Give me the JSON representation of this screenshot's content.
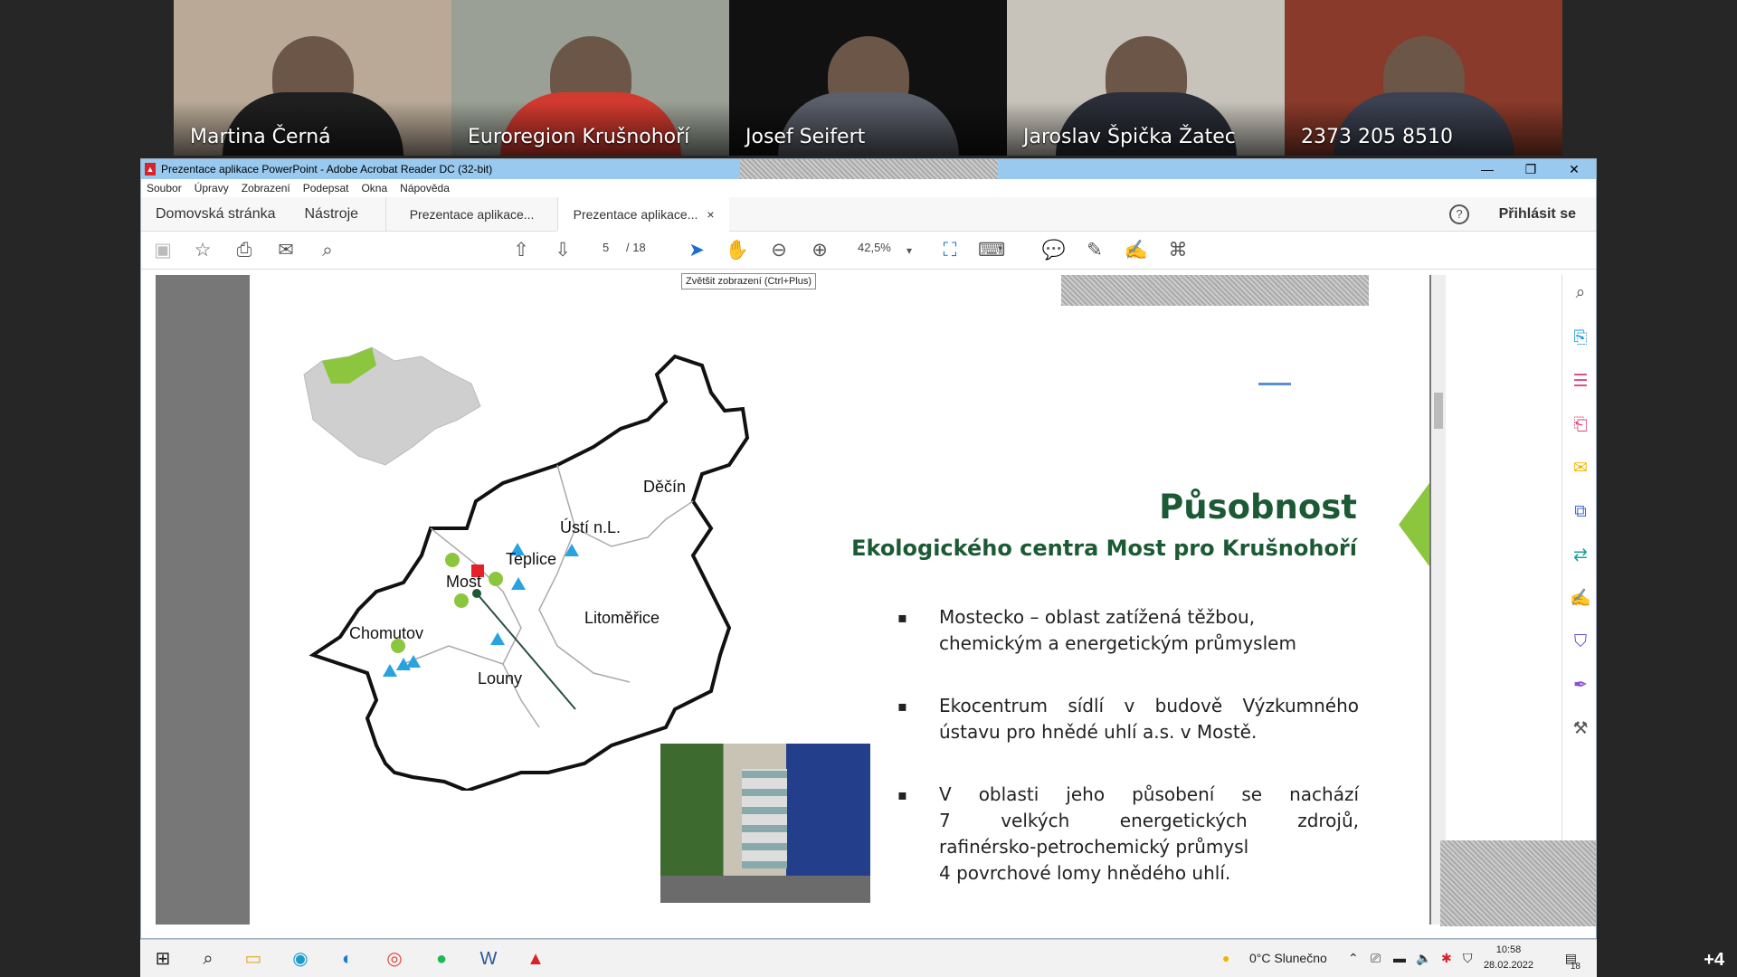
{
  "participants": [
    {
      "name": "Martina Černá",
      "bg": "#b9a996",
      "shirt": "#1f1f1f"
    },
    {
      "name": "Euroregion Krušnohoří",
      "bg": "#9aa095",
      "shirt": "#d33a2f"
    },
    {
      "name": "Josef Seifert",
      "bg": "#111111",
      "shirt": "#5b5f6a"
    },
    {
      "name": "Jaroslav Špička Žatec",
      "bg": "#c7c3ba",
      "shirt": "#2b2e39"
    },
    {
      "name": "2373 205 8510",
      "bg": "#8a3a2a",
      "shirt": "#3b4150"
    }
  ],
  "window": {
    "title": "Prezentace aplikace PowerPoint - Adobe Acrobat Reader DC (32-bit)",
    "minimize": "—",
    "maximize": "❐",
    "close": "✕"
  },
  "menu": [
    "Soubor",
    "Úpravy",
    "Zobrazení",
    "Podepsat",
    "Okna",
    "Nápověda"
  ],
  "tabs": {
    "home": "Domovská stránka",
    "tools": "Nástroje",
    "doc1": "Prezentace aplikace...",
    "doc2": "Prezentace aplikace...",
    "close": "×",
    "help": "?",
    "login": "Přihlásit se"
  },
  "toolbar": {
    "page_current": "5",
    "page_total": "/ 18",
    "zoom": "42,5%",
    "tooltip": "Zvětšit zobrazení (Ctrl+Plus)"
  },
  "slide": {
    "title": "Působnost",
    "subtitle": "Ekologického centra Most pro Krušnohoří",
    "bullets": [
      {
        "l1": "Mostecko – oblast zatížená těžbou,",
        "l2": "chemickým a energetickým průmyslem"
      },
      {
        "l1": "Ekocentrum sídlí  v budově  Výzkumného",
        "l2": "ústavu pro hnědé uhlí a.s. v Mostě."
      },
      {
        "l1": "V oblasti jeho působení se nachází",
        "l2": "7 velkých energetických zdrojů,",
        "l3": "rafinérsko-petrochemický průmysl",
        "l4": "4 povrchové lomy hnědého uhlí."
      }
    ],
    "map_labels": {
      "decin": "Děčín",
      "usti": "Ústí n.L.",
      "teplice": "Teplice",
      "most": "Most",
      "chomutov": "Chomutov",
      "litomerice": "Litoměřice",
      "louny": "Louny"
    },
    "colors": {
      "title": "#1c5a35",
      "green": "#8cc63f",
      "blue": "#29a3e0",
      "red": "#e32128"
    }
  },
  "taskbar": {
    "weather": "0°C  Slunečno",
    "time": "10:58",
    "date": "28.02.2022",
    "notif": "18",
    "more": "+4"
  }
}
